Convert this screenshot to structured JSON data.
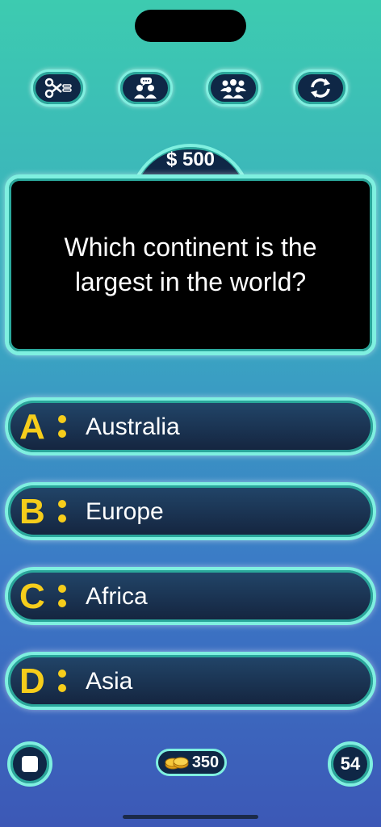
{
  "lifelines": [
    {
      "icon": "scissors-fifty-fifty-icon"
    },
    {
      "icon": "phone-a-friend-icon"
    },
    {
      "icon": "ask-audience-icon"
    },
    {
      "icon": "switch-question-icon"
    }
  ],
  "prize": "$ 500",
  "question": "Which continent is the largest in the world?",
  "answers": [
    {
      "letter": "A",
      "text": "Australia"
    },
    {
      "letter": "B",
      "text": "Europe"
    },
    {
      "letter": "C",
      "text": "Africa"
    },
    {
      "letter": "D",
      "text": "Asia"
    }
  ],
  "footer": {
    "stop_icon": "stop-icon",
    "coins": "350",
    "coins_icon": "coins-icon",
    "timer": "54"
  },
  "colors": {
    "accent_border": "#7ff0e0",
    "answer_letter": "#f6cd1b",
    "panel": "#0f2746",
    "question_bg": "#000000"
  }
}
